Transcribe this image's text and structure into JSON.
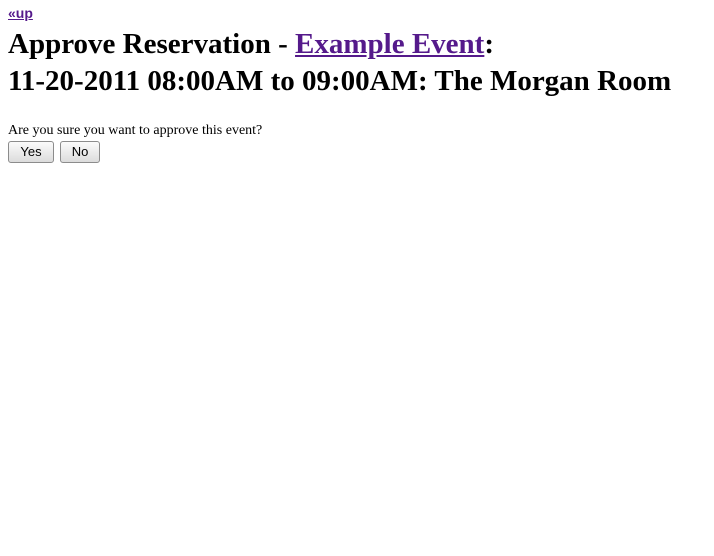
{
  "nav": {
    "up_label": "«up"
  },
  "heading": {
    "prefix": "Approve Reservation",
    "separator": " - ",
    "event_link": "Example Event",
    "colon": ":",
    "details": "11-20-2011 08:00AM to 09:00AM: The Morgan Room"
  },
  "confirm": {
    "question": "Are you sure you want to approve this event?",
    "yes_label": "Yes",
    "no_label": "No"
  },
  "colors": {
    "visited_link": "#551a8b",
    "text": "#000000",
    "background": "#ffffff"
  }
}
